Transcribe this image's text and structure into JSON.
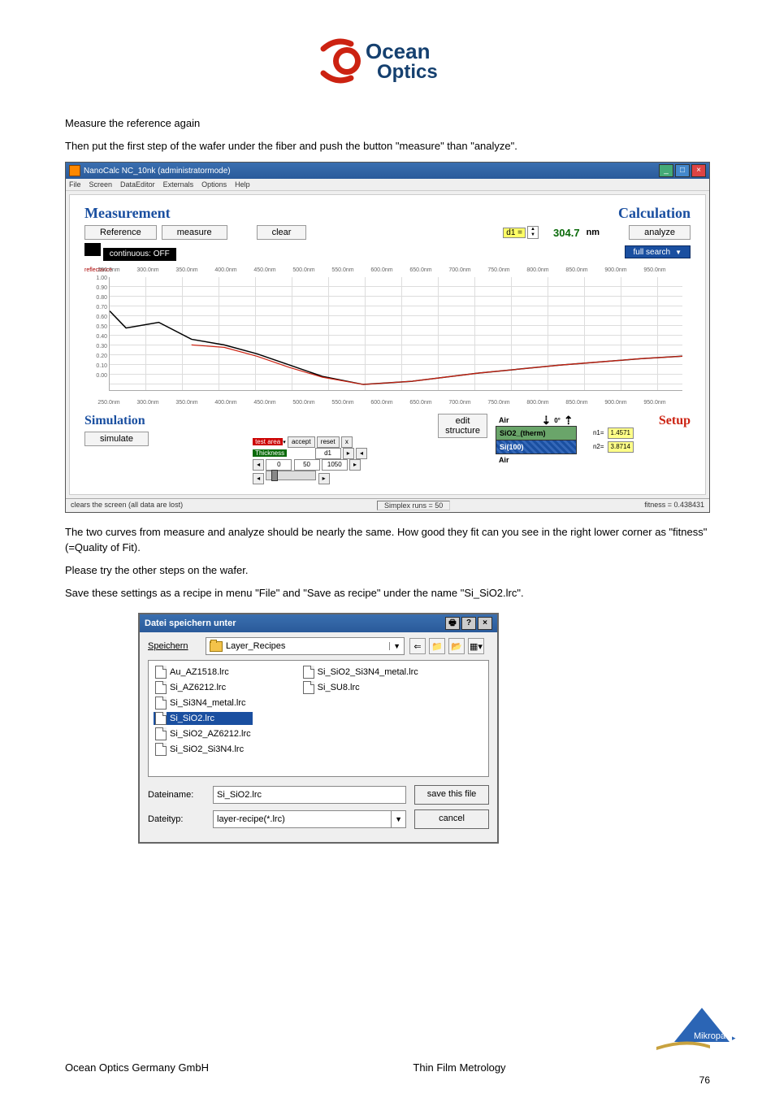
{
  "logo": {
    "brand_line1": "Ocean",
    "brand_line2": "Optics"
  },
  "text": {
    "p1": "Measure the reference again",
    "p2": "Then put the first step of the wafer under the fiber and push the button \"measure\" than \"analyze\".",
    "p3": "The two curves from measure and analyze should be nearly the same. How good they fit can you see in the right lower corner as \"fitness\" (=Quality of Fit).",
    "p4": "Please try the other steps on the wafer.",
    "p5": "Save these settings as a recipe in menu \"File\" and \"Save as recipe\" under the name \"Si_SiO2.lrc\"."
  },
  "app": {
    "title": "NanoCalc NC_10nk   (administratormode)",
    "menu": [
      "File",
      "Screen",
      "DataEditor",
      "Externals",
      "Options",
      "Help"
    ],
    "headings": {
      "measurement": "Measurement",
      "calculation": "Calculation",
      "simulation": "Simulation",
      "setup": "Setup"
    },
    "buttons": {
      "reference": "Reference",
      "measure": "measure",
      "clear": "clear",
      "analyze": "analyze",
      "simulate": "simulate",
      "edit_structure": "edit\nstructure",
      "full_search": "full search"
    },
    "continuous": "continuous:  OFF",
    "d1_label": "d1 =",
    "nm_value": "304.7",
    "nm_unit": "nm",
    "layers": {
      "air": "Air",
      "sio2": "SiO2_(therm)",
      "si": "Si(100)",
      "n1_lbl": "n1=",
      "n1": "1.4571",
      "n2_lbl": "n2=",
      "n2": "3.8714"
    },
    "test_area": {
      "hdr": "test area",
      "row": "Thickness",
      "accept": "accept",
      "reset": "reset",
      "v_left": "0",
      "v_center": "50",
      "v_right": "1050",
      "d_row": "d1"
    },
    "status": {
      "left": "clears the screen (all data are lost)",
      "mid": "Simplex runs = 50",
      "right": "fitness = 0.438431"
    }
  },
  "chart_data": {
    "type": "line",
    "title": "",
    "xlabel": "",
    "ylabel": "reflectance",
    "x_ticks": [
      "250.0nm",
      "300.0nm",
      "350.0nm",
      "400.0nm",
      "450.0nm",
      "500.0nm",
      "550.0nm",
      "600.0nm",
      "650.0nm",
      "700.0nm",
      "750.0nm",
      "800.0nm",
      "850.0nm",
      "900.0nm",
      "950.0nm"
    ],
    "y_ticks": [
      "1.00",
      "0.90",
      "0.80",
      "0.70",
      "0.60",
      "0.50",
      "0.40",
      "0.30",
      "0.20",
      "0.10",
      "0.00"
    ],
    "xlim": [
      250,
      950
    ],
    "ylim": [
      0.0,
      1.0
    ],
    "series": [
      {
        "name": "measure",
        "color": "#000000",
        "x": [
          250,
          270,
          310,
          350,
          390,
          430,
          470,
          510,
          560,
          620,
          700,
          800,
          900,
          950
        ],
        "y": [
          0.7,
          0.55,
          0.6,
          0.45,
          0.4,
          0.32,
          0.22,
          0.12,
          0.05,
          0.08,
          0.15,
          0.22,
          0.28,
          0.3
        ]
      },
      {
        "name": "analyze",
        "color": "#c21",
        "x": [
          350,
          390,
          430,
          470,
          510,
          560,
          620,
          700,
          800,
          900,
          950
        ],
        "y": [
          0.4,
          0.38,
          0.3,
          0.2,
          0.11,
          0.05,
          0.08,
          0.15,
          0.22,
          0.28,
          0.3
        ]
      }
    ]
  },
  "save_dialog": {
    "title": "Datei speichern unter",
    "save_in_label": "Speichern",
    "folder": "Layer_Recipes",
    "files_col1": [
      "Au_AZ1518.lrc",
      "Si_AZ6212.lrc",
      "Si_Si3N4_metal.lrc",
      "Si_SiO2.lrc",
      "Si_SiO2_AZ6212.lrc",
      "Si_SiO2_Si3N4.lrc"
    ],
    "files_col2": [
      "Si_SiO2_Si3N4_metal.lrc",
      "Si_SU8.lrc"
    ],
    "selected": "Si_SiO2.lrc",
    "filename_label": "Dateiname:",
    "filename": "Si_SiO2.lrc",
    "filetype_label": "Dateityp:",
    "filetype": "layer-recipe(*.lrc)",
    "save_btn": "save this file",
    "cancel_btn": "cancel"
  },
  "footer": {
    "left": "Ocean Optics Germany GmbH",
    "center": "Thin Film Metrology",
    "page": "76",
    "logo": "Mikropack"
  }
}
